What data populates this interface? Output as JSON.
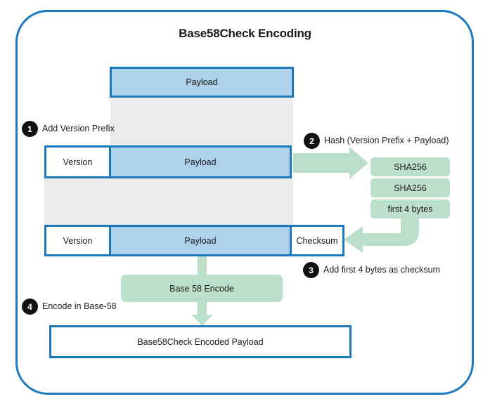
{
  "diagram": {
    "title": "Base58Check Encoding",
    "colors": {
      "border_blue": "#1b79c0",
      "payload_blue": "#afd2ec",
      "arrow_green": "#bcdfcb",
      "badge_black": "#111111",
      "band_grey": "#eaeaea"
    },
    "top_box": {
      "label": "Payload"
    },
    "row_version": {
      "version_label": "Version",
      "payload_label": "Payload"
    },
    "row_checksum": {
      "version_label": "Version",
      "payload_label": "Payload",
      "checksum_label": "Checksum"
    },
    "hash_chain": [
      {
        "label": "SHA256"
      },
      {
        "label": "SHA256"
      },
      {
        "label": "first 4 bytes"
      }
    ],
    "encode_box": {
      "label": "Base 58 Encode"
    },
    "output_box": {
      "label": "Base58Check Encoded Payload"
    },
    "steps": [
      {
        "number": "1",
        "label": "Add Version Prefix"
      },
      {
        "number": "2",
        "label": "Hash (Version Prefix + Payload)"
      },
      {
        "number": "3",
        "label": "Add first 4 bytes as checksum"
      },
      {
        "number": "4",
        "label": "Encode in Base-58"
      }
    ]
  }
}
